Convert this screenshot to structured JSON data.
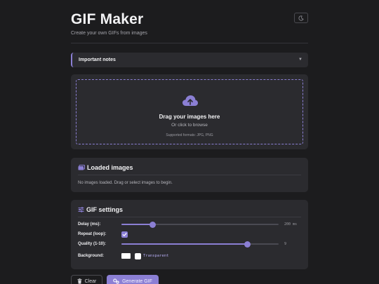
{
  "header": {
    "title": "GIF Maker",
    "subtitle": "Create your own GIFs from images",
    "theme_toggle_icon": "moon-icon"
  },
  "notes": {
    "label": "Important notes",
    "expand_icon": "chevron-down-icon"
  },
  "dropzone": {
    "icon": "cloud-upload-icon",
    "title": "Drag your images here",
    "subtitle": "Or click to browse",
    "formats": "Supported formats: JPG, PNG"
  },
  "loaded_images": {
    "icon": "images-icon",
    "title": "Loaded images",
    "empty_text": "No images loaded. Drag or select images to begin."
  },
  "settings": {
    "icon": "sliders-icon",
    "title": "GIF settings",
    "delay": {
      "label": "Delay (ms):",
      "value_text": "200 ms",
      "fraction": 0.2
    },
    "repeat": {
      "label": "Repeat (loop):",
      "checked": true
    },
    "quality": {
      "label": "Quality (1-10):",
      "value_text": "9",
      "fraction": 0.8
    },
    "background": {
      "label": "Background:",
      "color": "#ffffff",
      "transparent_label": "Transparent",
      "transparent_checked": false
    }
  },
  "actions": {
    "clear_label": "Clear",
    "clear_icon": "trash-icon",
    "generate_label": "Generate GIF",
    "generate_icon": "gear-icon"
  },
  "colors": {
    "accent": "#8b7fd4",
    "background": "#1c1c1e",
    "card": "#2b2b2f"
  }
}
